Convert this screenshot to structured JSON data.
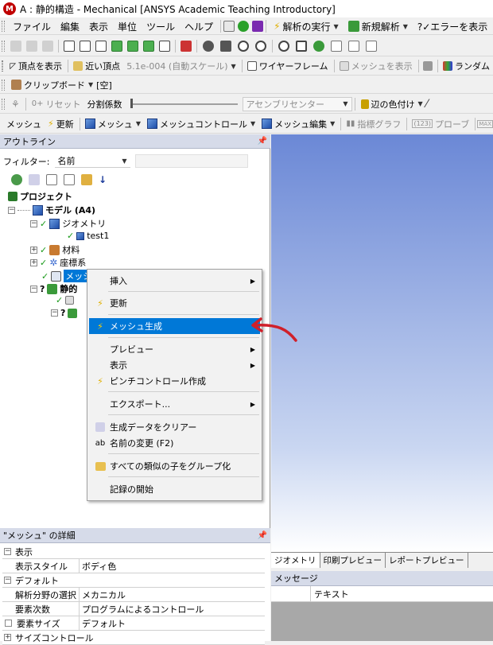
{
  "window": {
    "title": "A : 静的構造 - Mechanical [ANSYS Academic Teaching Introductory]"
  },
  "menu": [
    "ファイル",
    "編集",
    "表示",
    "単位",
    "ツール",
    "ヘルプ"
  ],
  "toolbar1": {
    "solve": "解析の実行",
    "new_analysis": "新規解析",
    "show_errors": "?✓エラーを表示"
  },
  "toolbar2": {
    "show_vertices": "頂点を表示",
    "close_vertices": "近い頂点",
    "scale": "5.1e-004 (自動スケール)",
    "wireframe": "ワイヤーフレーム",
    "show_mesh": "メッシュを表示",
    "random": "ランダム"
  },
  "toolbar3": {
    "clipboard": "クリップボード",
    "empty": "[空]"
  },
  "toolbar4": {
    "reset": "リセット",
    "explode": "分割係数",
    "assembly_center": "アセンブリセンター",
    "edge_coloring": "辺の色付け"
  },
  "toolbar5": {
    "mesh": "メッシュ",
    "update": "更新",
    "mesh_dd": "メッシュ",
    "mesh_control": "メッシュコントロール",
    "mesh_edit": "メッシュ編集",
    "metric_graph": "指標グラフ",
    "probe": "プローブ"
  },
  "outline": {
    "title": "アウトライン",
    "filter_label": "フィルター:",
    "filter_value": "名前"
  },
  "tree": {
    "project": "プロジェクト",
    "model": "モデル (A4)",
    "geometry": "ジオメトリ",
    "body": "test1",
    "materials": "材料",
    "coords": "座標系",
    "mesh": "メッシュ",
    "static": "静的"
  },
  "context_menu": {
    "insert": "挿入",
    "update": "更新",
    "generate_mesh": "メッシュ生成",
    "preview": "プレビュー",
    "show": "表示",
    "pinch": "ピンチコントロール作成",
    "export": "エクスポート...",
    "clear_data": "生成データをクリアー",
    "rename": "名前の変更 (F2)",
    "group_all": "すべての類似の子をグループ化",
    "start_recording": "記録の開始"
  },
  "details": {
    "title": "\"メッシュ\" の詳細",
    "sections": {
      "display": "表示",
      "defaults": "デフォルト",
      "sizing": "サイズコントロール"
    },
    "rows": [
      {
        "k": "表示スタイル",
        "v": "ボディ色"
      },
      {
        "k": "解析分野の選択",
        "v": "メカニカル"
      },
      {
        "k": "要素次数",
        "v": "プログラムによるコントロール"
      },
      {
        "k": "要素サイズ",
        "v": "デフォルト"
      }
    ]
  },
  "viewer_tabs": [
    "ジオメトリ",
    "印刷プレビュー",
    "レポートプレビュー"
  ],
  "messages": {
    "title": "メッセージ",
    "col_text": "テキスト"
  },
  "colors": {
    "viewport_top": "#6b88d6",
    "viewport_bottom": "#ffffff",
    "accent": "#0078d7",
    "annotation": "#d0202a"
  }
}
